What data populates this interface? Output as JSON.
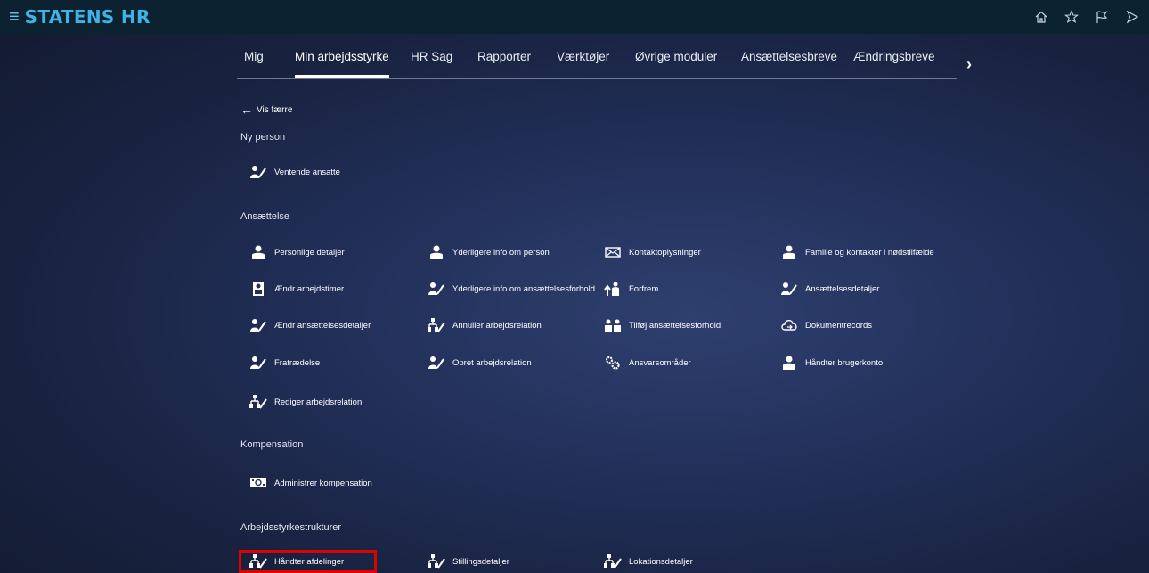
{
  "header": {
    "title": "STATENS HR"
  },
  "top_icons": [
    "home-icon",
    "star-icon",
    "flag-icon",
    "play-icon"
  ],
  "tabs": [
    "Mig",
    "Min arbejdsstyrke",
    "HR Sag",
    "Rapporter",
    "Værktøjer",
    "Øvrige moduler",
    "Ansættelsesbreve",
    "Ændringsbreve"
  ],
  "active_tab": "Min arbejdsstyrke",
  "back_label": "Vis færre",
  "sections": {
    "ny_person": {
      "title": "Ny person",
      "items": [
        "Ventende ansatte"
      ]
    },
    "ansaettelse": {
      "title": "Ansættelse",
      "items": [
        "Personlige detaljer",
        "Yderligere info om person",
        "Kontaktoplysninger",
        "Familie og kontakter i nødstilfælde",
        "Ændr arbejdstimer",
        "Yderligere info om ansættelsesforhold",
        "Forfrem",
        "Ansættelsesdetaljer",
        "Ændr ansættelsesdetaljer",
        "Annuller arbejdsrelation",
        "Tilføj ansættelsesforhold",
        "Dokumentrecords",
        "Fratrædelse",
        "Opret arbejdsrelation",
        "Ansvarsområder",
        "Håndter brugerkonto",
        "Rediger arbejdsrelation"
      ]
    },
    "kompensation": {
      "title": "Kompensation",
      "items": [
        "Administrer kompensation"
      ]
    },
    "strukturer": {
      "title": "Arbejdsstyrkestrukturer",
      "items": [
        "Håndter afdelinger",
        "Stillingsdetaljer",
        "Lokationsdetaljer"
      ]
    }
  }
}
